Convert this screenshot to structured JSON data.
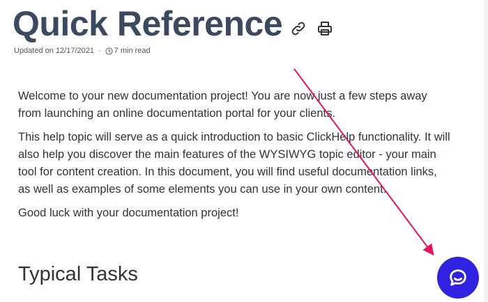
{
  "header": {
    "title": "Quick Reference",
    "link_icon": "link-icon",
    "print_icon": "print-icon"
  },
  "meta": {
    "updated": "Updated on 12/17/2021",
    "separator": "·",
    "clock_icon": "clock-icon",
    "read_time": "7 min read"
  },
  "content": {
    "paragraphs": [
      "Welcome to your new documentation project! You are now just a few steps away from launching an online documentation portal for your clients.",
      "This help topic will serve as a quick introduction to basic ClickHelp functionality. It will also help you discover the main features of the WYSIWYG topic editor - your main tool for content creation. In this document, you will find useful documentation links, as well as examples of some elements you can use in your own content.",
      "Good luck with your documentation project!"
    ],
    "section_heading": "Typical Tasks"
  },
  "chat": {
    "icon": "chat-bubble-icon",
    "color": "#2f22e0"
  },
  "colors": {
    "title": "#3b4a5e",
    "annotation_arrow": "#e0155f"
  }
}
